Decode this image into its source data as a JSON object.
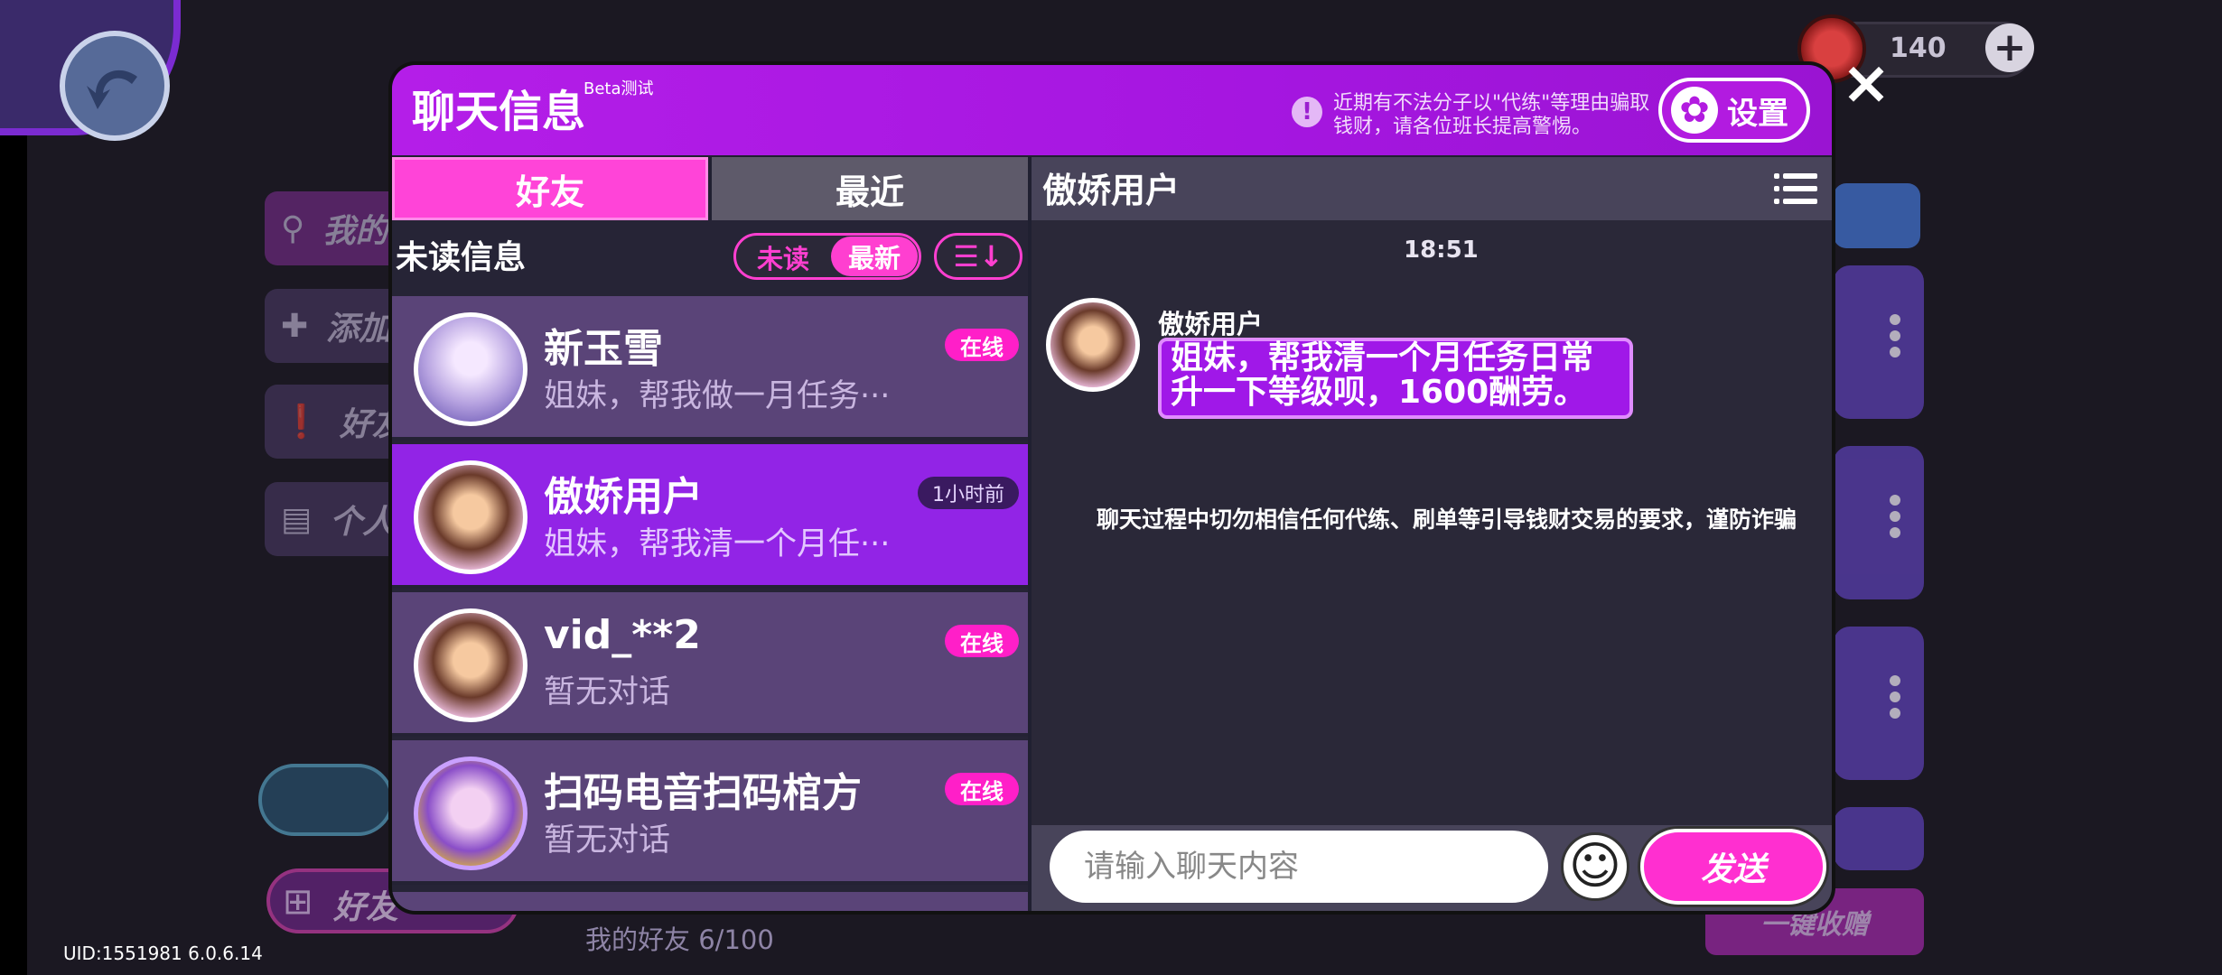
{
  "uid_text": "UID:1551981 6.0.6.14",
  "friends_count": "我的好友 6/100",
  "currency": {
    "value": "140",
    "add_symbol": "+",
    "coin_color": "#d94040"
  },
  "background_buttons": [
    {
      "label": "我的"
    },
    {
      "label": "添加"
    },
    {
      "label": "好友"
    },
    {
      "label": "个人"
    }
  ],
  "bottom_gift_label": "好友",
  "claim_all_label": "一键收赠",
  "dialog": {
    "title": "聊天信息",
    "beta": "Beta测试",
    "warning": "近期有不法分子以\"代练\"等理由骗取钱财，请各位班长提高警惕。",
    "warning_icon": "!",
    "settings_label": "设置",
    "close_symbol": "×",
    "accent_color": "#ff3fd0"
  },
  "tabs": {
    "friends": "好友",
    "recent": "最近"
  },
  "list": {
    "section_label": "未读信息",
    "filter_unread": "未读",
    "filter_newest": "最新",
    "sort_icon": "☰↓",
    "items": [
      {
        "name": "新玉雪",
        "preview": "姐妹，帮我做一月任务···",
        "status": "在线"
      },
      {
        "name": "傲娇用户",
        "preview": "姐妹，帮我清一个月任···",
        "status": "1小时前"
      },
      {
        "name": "vid_**2",
        "preview": "暂无对话",
        "status": "在线"
      },
      {
        "name": "扫码电音扫码棺方",
        "preview": "暂无对话",
        "status": "在线"
      }
    ]
  },
  "chat": {
    "title": "傲娇用户",
    "time": "18:51",
    "sender": "傲娇用户",
    "message": "姐妹，帮我清一个月任务日常\n升一下等级呗，1600酬劳。",
    "system_warning": "聊天过程中切勿相信任何代练、刷单等引导钱财交易的要求，谨防诈骗",
    "input_placeholder": "请输入聊天内容",
    "emoji_icon": "☺",
    "send_label": "发送"
  }
}
